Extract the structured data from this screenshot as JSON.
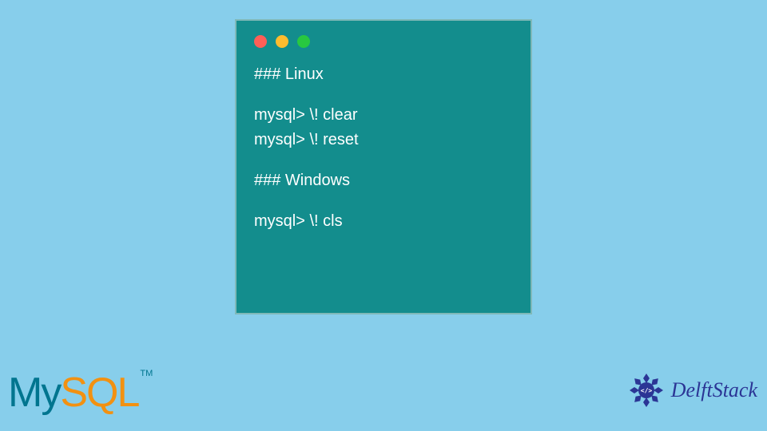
{
  "terminal": {
    "lines": [
      {
        "type": "heading",
        "text": "### Linux"
      },
      {
        "type": "spacer"
      },
      {
        "type": "code",
        "text": "mysql> \\! clear"
      },
      {
        "type": "code",
        "text": "mysql> \\! reset"
      },
      {
        "type": "spacer"
      },
      {
        "type": "heading",
        "text": "### Windows"
      },
      {
        "type": "spacer"
      },
      {
        "type": "code",
        "text": "mysql> \\! cls"
      }
    ]
  },
  "logos": {
    "mysql": {
      "part1": "My",
      "part2": "SQL",
      "tm": "TM"
    },
    "delftstack": {
      "text": "DelftStack"
    }
  },
  "colors": {
    "background": "#87ceeb",
    "terminal_bg": "#138d8d",
    "terminal_text": "#ffffff",
    "mysql_dark": "#00758f",
    "mysql_orange": "#f29111",
    "delftstack_blue": "#2b3595"
  }
}
